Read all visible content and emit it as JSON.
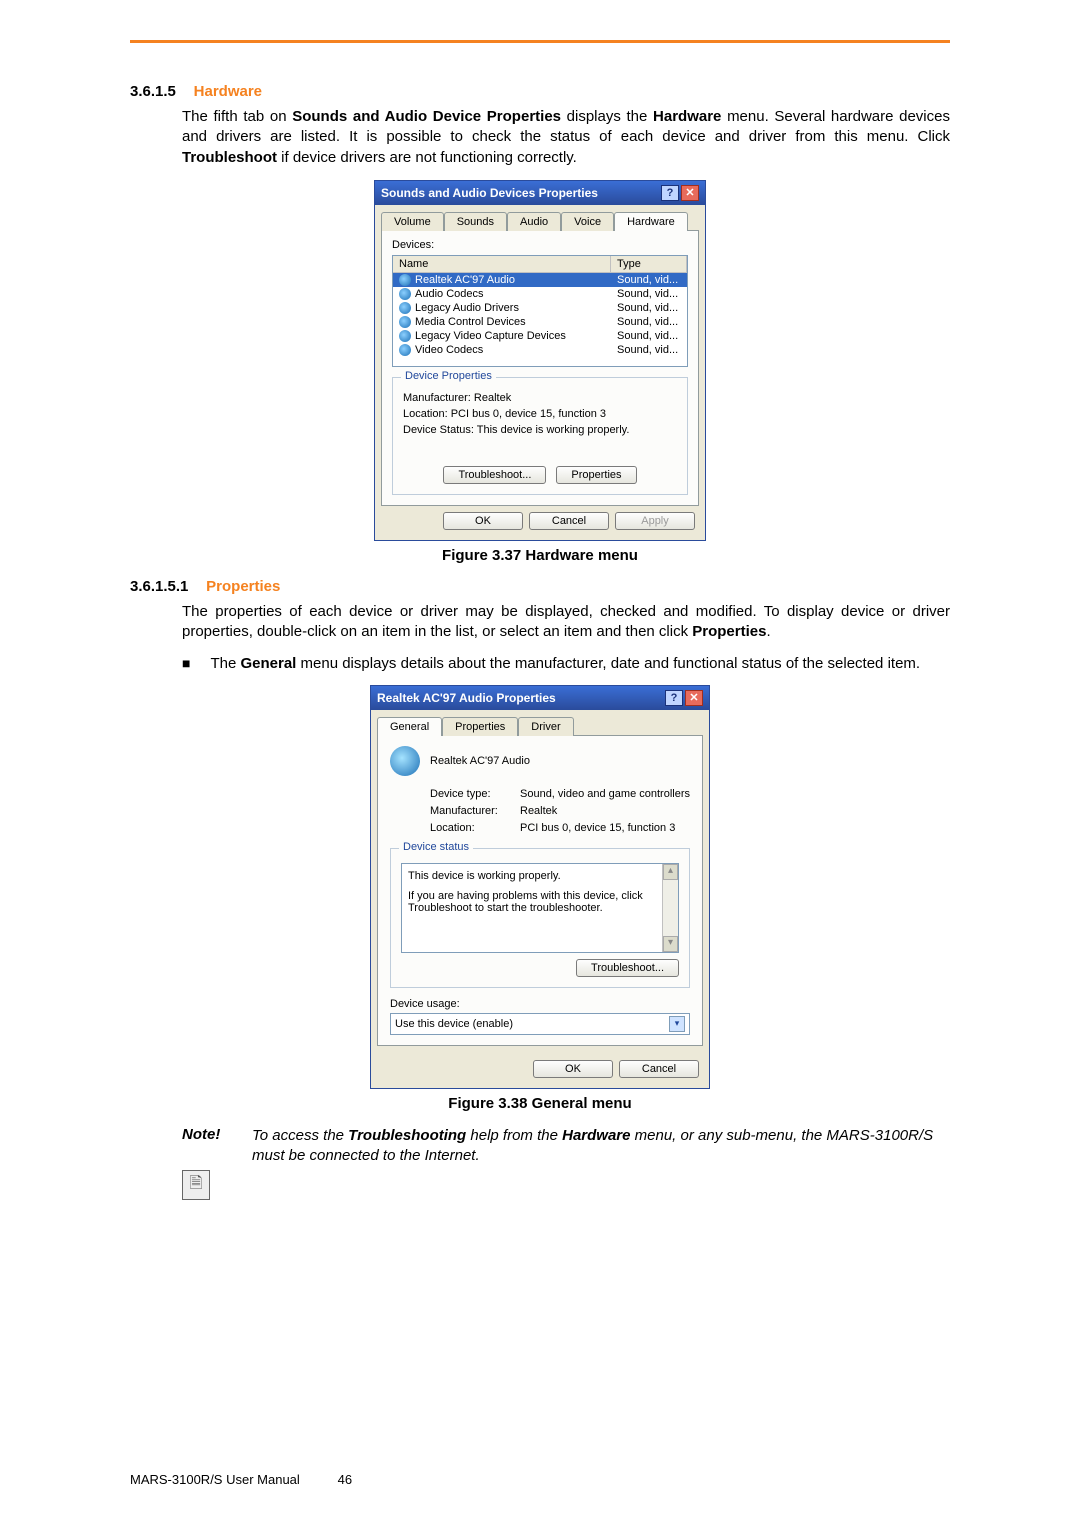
{
  "section1": {
    "num": "3.6.1.5",
    "title": "Hardware",
    "para_parts": [
      "The fifth tab on ",
      "Sounds and Audio Device Properties",
      " displays the ",
      "Hardware",
      " menu. Several hardware devices and drivers are listed. It is possible to check the status of each device and driver from this menu. Click ",
      "Troubleshoot",
      " if device drivers are not functioning correctly."
    ]
  },
  "dlg1": {
    "title": "Sounds and Audio Devices Properties",
    "help": "?",
    "close": "✕",
    "tabs": [
      "Volume",
      "Sounds",
      "Audio",
      "Voice",
      "Hardware"
    ],
    "devices_label": "Devices:",
    "cols": {
      "name": "Name",
      "type": "Type"
    },
    "rows": [
      {
        "name": "Realtek AC'97 Audio",
        "type": "Sound, vid...",
        "sel": true
      },
      {
        "name": "Audio Codecs",
        "type": "Sound, vid...",
        "sel": false
      },
      {
        "name": "Legacy Audio Drivers",
        "type": "Sound, vid...",
        "sel": false
      },
      {
        "name": "Media Control Devices",
        "type": "Sound, vid...",
        "sel": false
      },
      {
        "name": "Legacy Video Capture Devices",
        "type": "Sound, vid...",
        "sel": false
      },
      {
        "name": "Video Codecs",
        "type": "Sound, vid...",
        "sel": false
      }
    ],
    "group_title": "Device Properties",
    "manufacturer": "Manufacturer: Realtek",
    "location": "Location: PCI bus 0, device 15, function 3",
    "status": "Device Status: This device is working properly.",
    "btn_troubleshoot": "Troubleshoot...",
    "btn_properties": "Properties",
    "btn_ok": "OK",
    "btn_cancel": "Cancel",
    "btn_apply": "Apply"
  },
  "fig1_caption": "Figure 3.37 Hardware menu",
  "section2": {
    "num": "3.6.1.5.1",
    "title": "Properties",
    "para_parts": [
      "The properties of each device or driver may be displayed, checked and modified. To display device or driver properties, double-click on an item in the list, or select an item and then click ",
      "Properties",
      "."
    ]
  },
  "bullet": {
    "parts": [
      "The ",
      "General",
      " menu displays details about the manufacturer, date and functional status of the selected item."
    ]
  },
  "dlg2": {
    "title": "Realtek AC'97 Audio Properties",
    "help": "?",
    "close": "✕",
    "tabs": [
      "General",
      "Properties",
      "Driver"
    ],
    "device_name": "Realtek AC'97 Audio",
    "rows": [
      {
        "label": "Device type:",
        "value": "Sound, video and game controllers"
      },
      {
        "label": "Manufacturer:",
        "value": "Realtek"
      },
      {
        "label": "Location:",
        "value": "PCI bus 0, device 15, function 3"
      }
    ],
    "status_group": "Device status",
    "status_line1": "This device is working properly.",
    "status_line2": "If you are having problems with this device, click Troubleshoot to start the troubleshooter.",
    "btn_troubleshoot": "Troubleshoot...",
    "usage_label": "Device usage:",
    "usage_value": "Use this device (enable)",
    "btn_ok": "OK",
    "btn_cancel": "Cancel"
  },
  "fig2_caption": "Figure 3.38 General menu",
  "note": {
    "label": "Note!",
    "parts": [
      "To access the ",
      "Troubleshooting",
      " help from the ",
      "Hardware",
      " menu, or any sub-menu, the MARS-3100R/S must be connected to the Internet."
    ]
  },
  "footer": {
    "left": "MARS-3100R/S User Manual",
    "page": "46"
  }
}
